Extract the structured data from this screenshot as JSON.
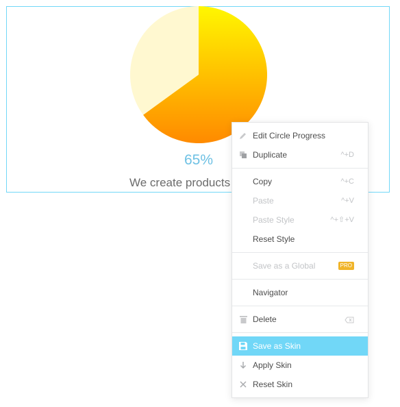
{
  "widget": {
    "percent_text": "65%",
    "caption": "We create products",
    "progress_fraction": 0.65,
    "gradient_start": "#FFF700",
    "gradient_end": "#FF8A00",
    "remainder_color": "#FFF8D0",
    "frame_color": "#71D7F7"
  },
  "menu": {
    "items": [
      {
        "label": "Edit Circle Progress",
        "icon": "pencil-icon"
      },
      {
        "label": "Duplicate",
        "icon": "duplicate-icon",
        "shortcut": "^+D"
      },
      {
        "label": "Copy",
        "shortcut": "^+C"
      },
      {
        "label": "Paste",
        "shortcut": "^+V",
        "disabled": true
      },
      {
        "label": "Paste Style",
        "shortcut": "^+⇧+V",
        "disabled": true
      },
      {
        "label": "Reset Style"
      },
      {
        "label": "Save as a Global",
        "badge": "PRO",
        "disabled": true
      },
      {
        "label": "Navigator"
      },
      {
        "label": "Delete",
        "icon": "trash-icon",
        "shortcut_icon": "delete-key-icon"
      },
      {
        "label": "Save as Skin",
        "icon": "save-icon",
        "active": true
      },
      {
        "label": "Apply Skin",
        "icon": "arrow-down-icon"
      },
      {
        "label": "Reset Skin",
        "icon": "close-icon"
      }
    ],
    "active_color": "#71D7F7"
  }
}
